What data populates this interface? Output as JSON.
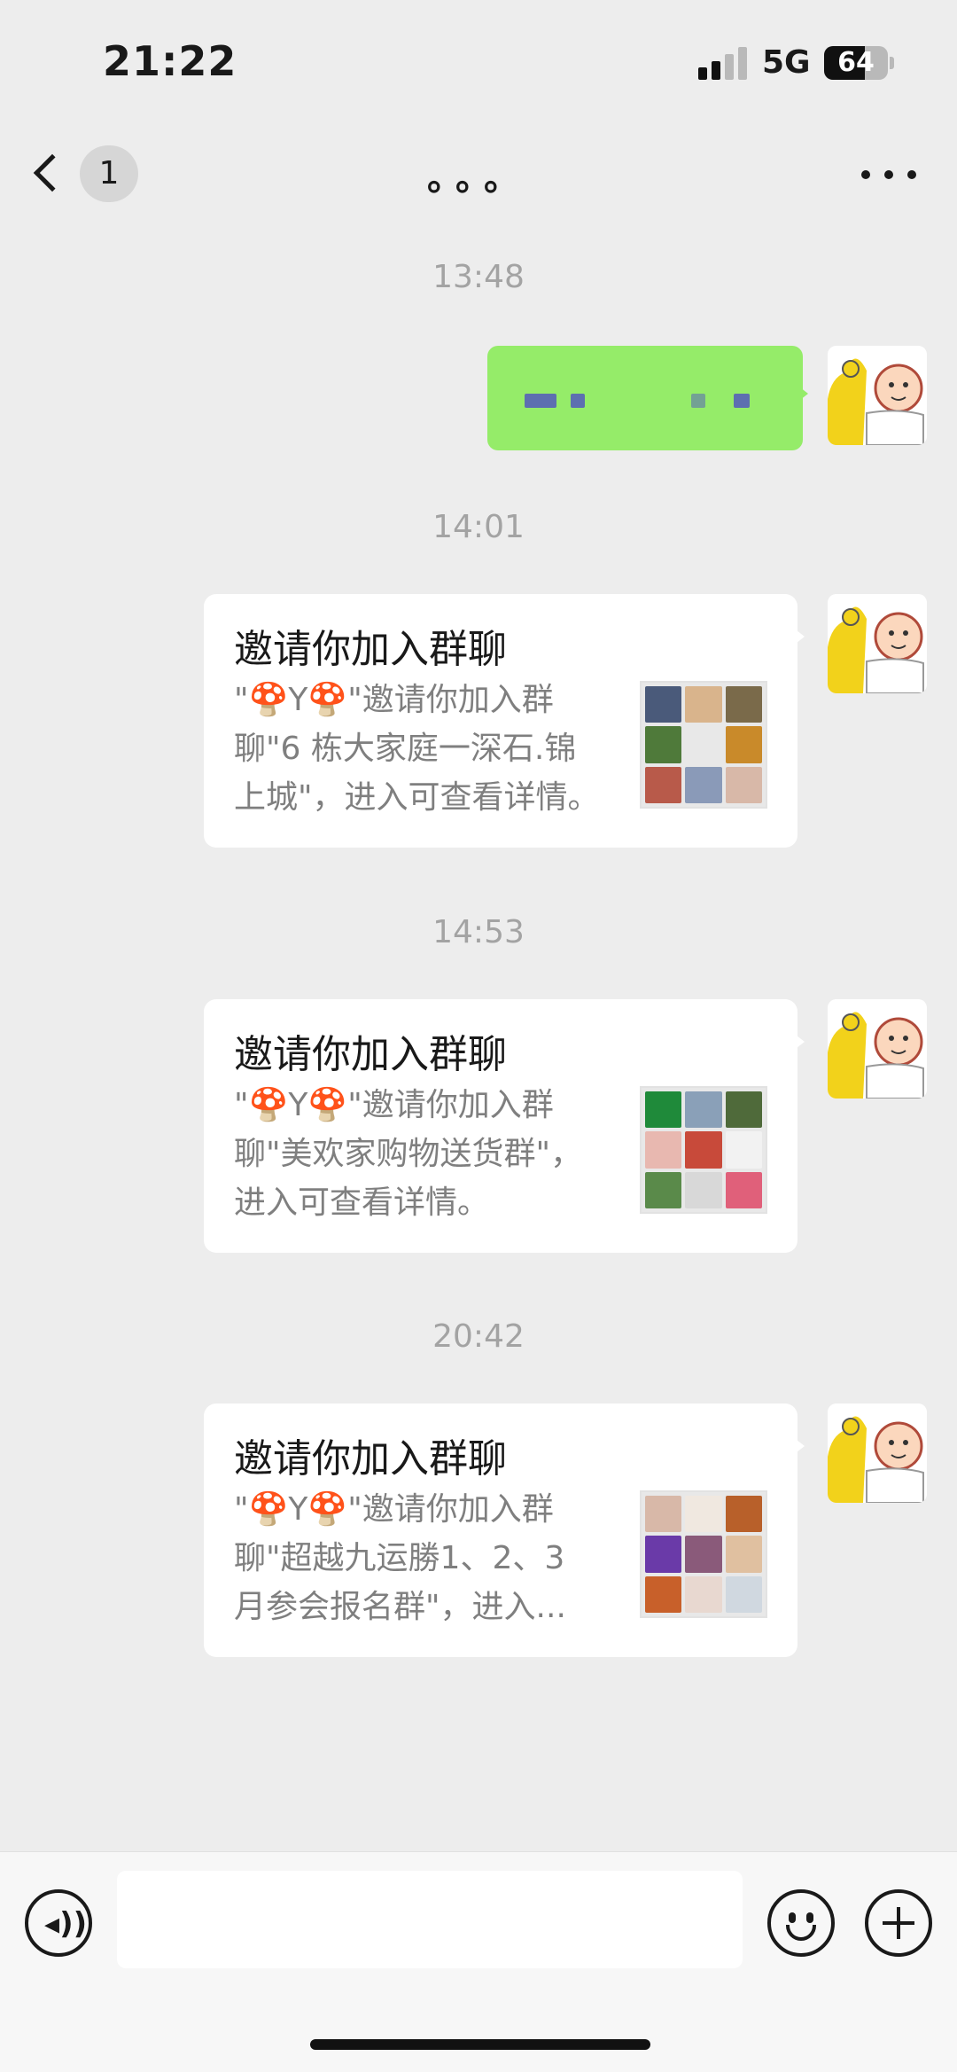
{
  "status_bar": {
    "time": "21:22",
    "network": "5G",
    "battery": "64",
    "battery_level": 0.64
  },
  "nav": {
    "unread_count": "1",
    "title": "。。。",
    "more_icon": "more-dots-icon",
    "back_icon": "chevron-left-icon"
  },
  "messages": [
    {
      "timestamp": "13:48",
      "type": "text",
      "content": ""
    },
    {
      "timestamp": "14:01",
      "type": "group_invite",
      "title": "邀请你加入群聊",
      "desc_lines": [
        "\"🍄Y🍄\"邀请你加入群",
        "聊\"6 栋大家庭一深石.锦",
        "上城\"，进入可查看详情。"
      ]
    },
    {
      "timestamp": "14:53",
      "type": "group_invite",
      "title": "邀请你加入群聊",
      "desc_lines": [
        "\"🍄Y🍄\"邀请你加入群",
        "聊\"美欢家购物送货群\"，",
        "进入可查看详情。"
      ]
    },
    {
      "timestamp": "20:42",
      "type": "group_invite",
      "title": "邀请你加入群聊",
      "desc_lines": [
        "\"🍄Y🍄\"邀请你加入群",
        "聊\"超越九运勝1、2、3",
        "月参会报名群\"，进入..."
      ]
    }
  ],
  "input_bar": {
    "voice_icon": "voice-icon",
    "emoji_icon": "emoji-icon",
    "add_icon": "plus-icon",
    "input_value": ""
  },
  "colors": {
    "background": "#ededed",
    "sent_bubble": "#95ec69",
    "card_background": "#ffffff",
    "timestamp_text": "#a3a3a3",
    "description_text": "#7f7f7f"
  }
}
